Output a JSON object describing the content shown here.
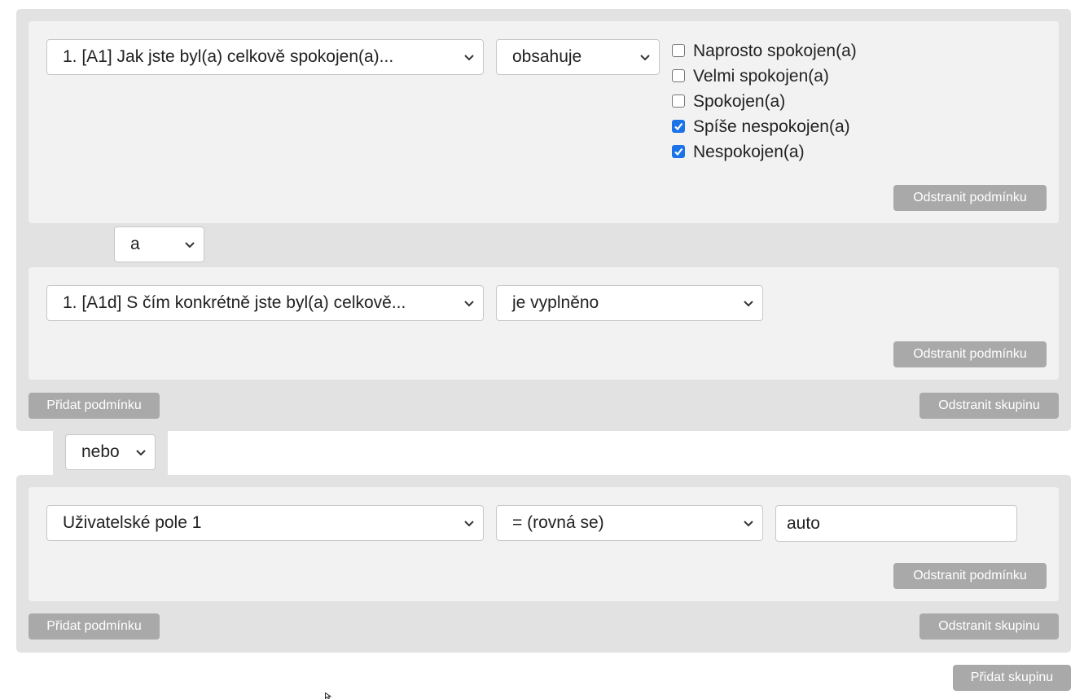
{
  "groups": [
    {
      "conditions": [
        {
          "field_value": "1. [A1] Jak jste byl(a) celkově spokojen(a)...",
          "operator_value": "obsahuje",
          "options": [
            {
              "label": "Naprosto spokojen(a)",
              "checked": false
            },
            {
              "label": "Velmi spokojen(a)",
              "checked": false
            },
            {
              "label": "Spokojen(a)",
              "checked": false
            },
            {
              "label": "Spíše nespokojen(a)",
              "checked": true
            },
            {
              "label": "Nespokojen(a)",
              "checked": true
            }
          ],
          "remove_label": "Odstranit podmínku"
        },
        {
          "field_value": "1. [A1d] S čím konkrétně jste byl(a) celkově...",
          "operator_value": "je vyplněno",
          "remove_label": "Odstranit podmínku"
        }
      ],
      "condition_connector": "a",
      "add_condition_label": "Přidat podmínku",
      "remove_group_label": "Odstranit skupinu"
    },
    {
      "conditions": [
        {
          "field_value": "Uživatelské pole 1",
          "operator_value": "= (rovná se)",
          "text_value": "auto",
          "remove_label": "Odstranit podmínku"
        }
      ],
      "add_condition_label": "Přidat podmínku",
      "remove_group_label": "Odstranit skupinu"
    }
  ],
  "group_connector": "nebo",
  "add_group_label": "Přidat skupinu",
  "colors": {
    "group_bg": "#e2e2e2",
    "condition_bg": "#f2f2f2",
    "button_bg": "#a9a9a9",
    "checkbox_checked": "#1a73e8"
  },
  "icons": {
    "dropdown": "chevron-down-icon",
    "checkmark": "checkmark-icon",
    "cursor": "mouse-pointer-icon"
  }
}
